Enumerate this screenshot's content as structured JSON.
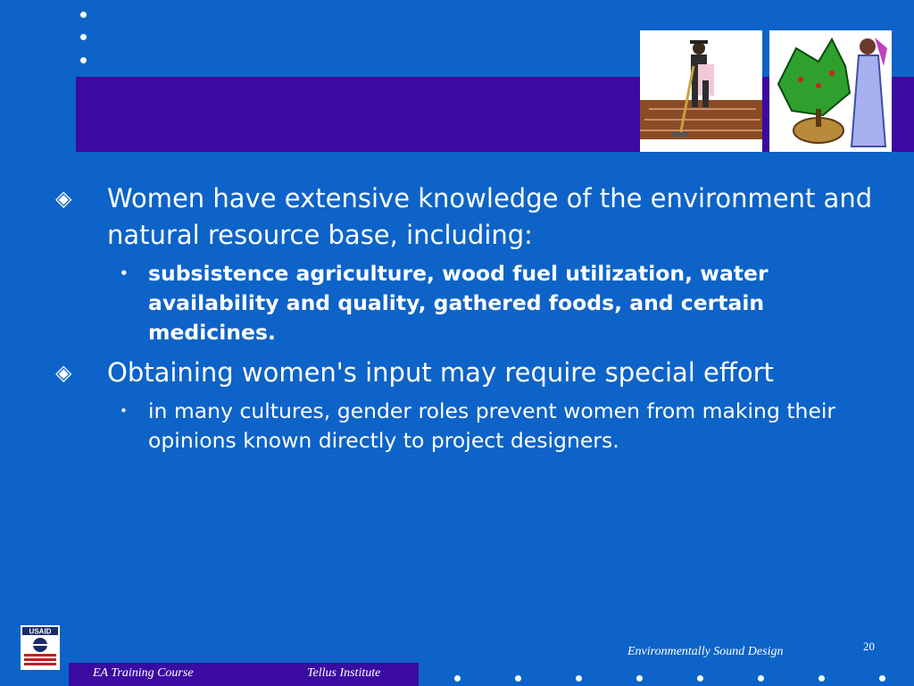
{
  "slide": {
    "bullets": [
      {
        "text": "Women have extensive knowledge of the environment and natural resource base, including:",
        "sub": "subsistence agriculture, wood fuel utilization, water availability and quality, gathered foods, and certain medicines."
      },
      {
        "text": "Obtaining women's input may require special effort",
        "sub": "in many cultures, gender roles prevent women from making their opinions known directly to project designers."
      }
    ],
    "bullet_symbol": "◈",
    "sub_bullet_symbol": "•"
  },
  "footer": {
    "course": "EA Training Course",
    "organization": "Tellus Institute",
    "title": "Environmentally Sound Design",
    "page_number": "20",
    "logo_text": "USAID"
  },
  "colors": {
    "background": "#0d63c7",
    "title_band": "#3b0aa0",
    "text": "#ffffff"
  },
  "icons": [
    "farmer-clipart-icon",
    "fruit-gatherer-clipart-icon",
    "usaid-logo-icon"
  ]
}
